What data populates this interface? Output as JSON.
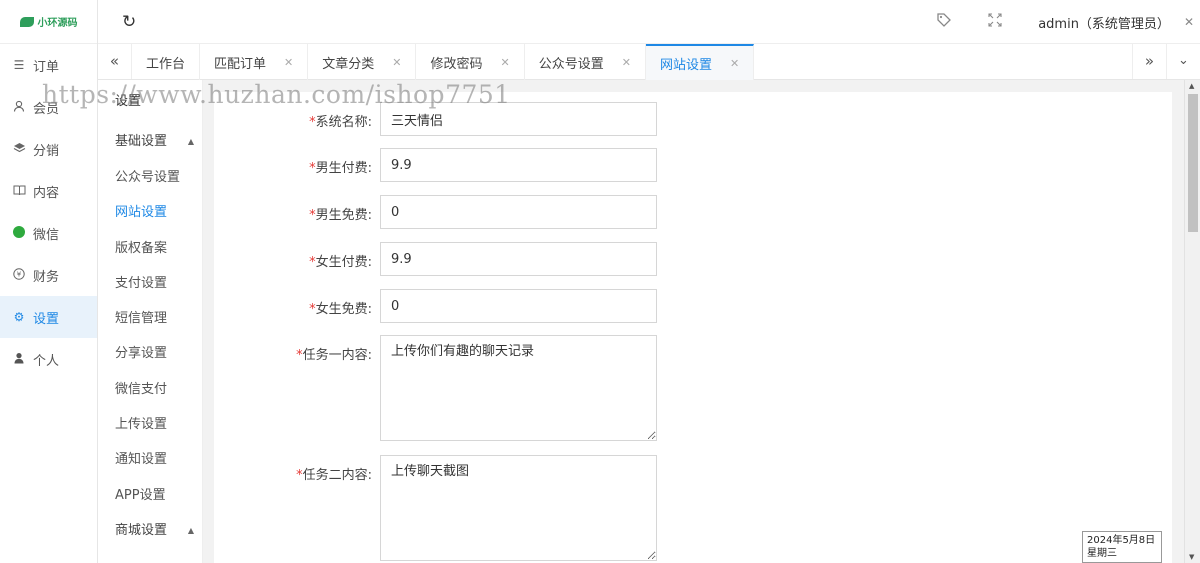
{
  "logo": {
    "text": "小环源码"
  },
  "sidebar": {
    "items": [
      {
        "label": "订单",
        "icon": "list-icon"
      },
      {
        "label": "会员",
        "icon": "user-icon"
      },
      {
        "label": "分销",
        "icon": "layers-icon"
      },
      {
        "label": "内容",
        "icon": "book-icon"
      },
      {
        "label": "微信",
        "icon": "wechat-icon"
      },
      {
        "label": "财务",
        "icon": "yen-icon"
      },
      {
        "label": "设置",
        "icon": "gear-icon"
      },
      {
        "label": "个人",
        "icon": "person-icon"
      }
    ]
  },
  "header": {
    "user": "admin（系统管理员）"
  },
  "tabs": [
    {
      "label": "工作台"
    },
    {
      "label": "匹配订单"
    },
    {
      "label": "文章分类"
    },
    {
      "label": "修改密码"
    },
    {
      "label": "公众号设置"
    },
    {
      "label": "网站设置"
    }
  ],
  "submenu": {
    "title": "设置",
    "group1": "基础设置",
    "items": [
      "公众号设置",
      "网站设置",
      "版权备案",
      "支付设置",
      "短信管理",
      "分享设置",
      "微信支付",
      "上传设置",
      "通知设置",
      "APP设置"
    ],
    "group2": "商城设置"
  },
  "form": {
    "system_name": {
      "label": "系统名称:",
      "value": "三天情侣"
    },
    "male_fee": {
      "label": "男生付费:",
      "value": "9.9"
    },
    "male_free": {
      "label": "男生免费:",
      "value": "0"
    },
    "female_fee": {
      "label": "女生付费:",
      "value": "9.9"
    },
    "female_free": {
      "label": "女生免费:",
      "value": "0"
    },
    "task1": {
      "label": "任务一内容:",
      "value": "上传你们有趣的聊天记录"
    },
    "task2": {
      "label": "任务二内容:",
      "value": "上传聊天截图"
    }
  },
  "watermark": "https://www.huzhan.com/ishop7751",
  "datebox": {
    "date": "2024年5月8日",
    "weekday": "星期三"
  }
}
